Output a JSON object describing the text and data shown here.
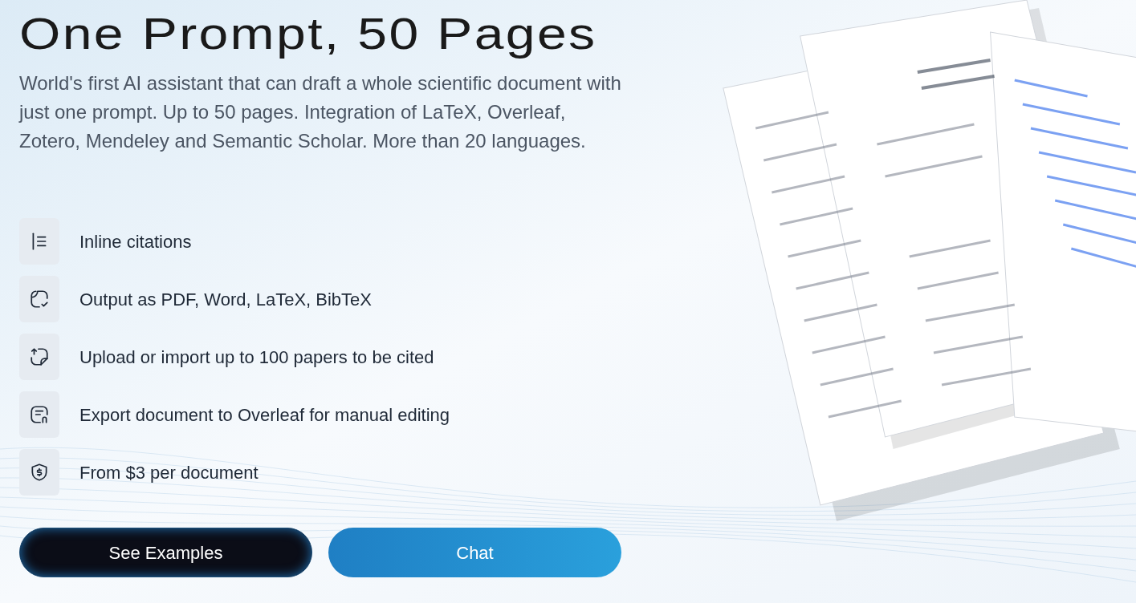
{
  "hero": {
    "title": "One Prompt, 50 Pages",
    "description": "World's first AI assistant that can draft a whole scientific document with just one prompt. Up to 50 pages. Integration of LaTeX, Overleaf, Zotero, Mendeley and Semantic Scholar. More than 20 languages."
  },
  "features": [
    {
      "kind": "citations",
      "label": "Inline citations"
    },
    {
      "kind": "output",
      "label": "Output as PDF, Word, LaTeX, BibTeX"
    },
    {
      "kind": "upload",
      "label": "Upload or import up to 100 papers to be cited"
    },
    {
      "kind": "export",
      "label": "Export document to Overleaf for manual editing"
    },
    {
      "kind": "price",
      "label": "From $3 per document"
    }
  ],
  "buttons": [
    {
      "kind": "dark",
      "label": "See Examples"
    },
    {
      "kind": "primary",
      "label": "Chat"
    }
  ]
}
